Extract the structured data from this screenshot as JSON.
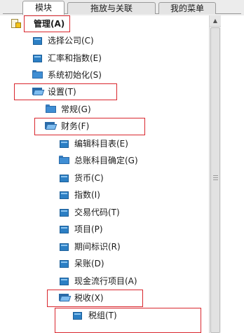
{
  "tabs": [
    {
      "label": "模块",
      "active": true
    },
    {
      "label": "拖放与关联",
      "active": false
    },
    {
      "label": "我的菜单",
      "active": false
    }
  ],
  "tree": {
    "root": {
      "label": "管理(A)",
      "icon": "module-root-icon"
    },
    "items": [
      {
        "label": "选择公司(C)",
        "icon": "leaf-icon",
        "level": 1
      },
      {
        "label": "汇率和指数(E)",
        "icon": "leaf-icon",
        "level": 1
      },
      {
        "label": "系统初始化(S)",
        "icon": "folder-icon",
        "level": 1
      },
      {
        "label": "设置(T)",
        "icon": "open-folder-icon",
        "level": 1
      },
      {
        "label": "常规(G)",
        "icon": "folder-icon",
        "level": 2
      },
      {
        "label": "财务(F)",
        "icon": "open-folder-icon",
        "level": 2
      },
      {
        "label": "编辑科目表(E)",
        "icon": "leaf-icon",
        "level": 3
      },
      {
        "label": "总账科目确定(G)",
        "icon": "folder-icon",
        "level": 3
      },
      {
        "label": "货币(C)",
        "icon": "leaf-icon",
        "level": 3
      },
      {
        "label": "指数(I)",
        "icon": "leaf-icon",
        "level": 3
      },
      {
        "label": "交易代码(T)",
        "icon": "leaf-icon",
        "level": 3
      },
      {
        "label": "项目(P)",
        "icon": "leaf-icon",
        "level": 3
      },
      {
        "label": "期间标识(R)",
        "icon": "leaf-icon",
        "level": 3
      },
      {
        "label": "呆账(D)",
        "icon": "leaf-icon",
        "level": 3
      },
      {
        "label": "现金流行项目(A)",
        "icon": "leaf-icon",
        "level": 3
      },
      {
        "label": "税收(X)",
        "icon": "open-folder-icon",
        "level": 3
      },
      {
        "label": "税组(T)",
        "icon": "leaf-icon",
        "level": 4
      }
    ]
  },
  "highlight_color": "#d9272e"
}
